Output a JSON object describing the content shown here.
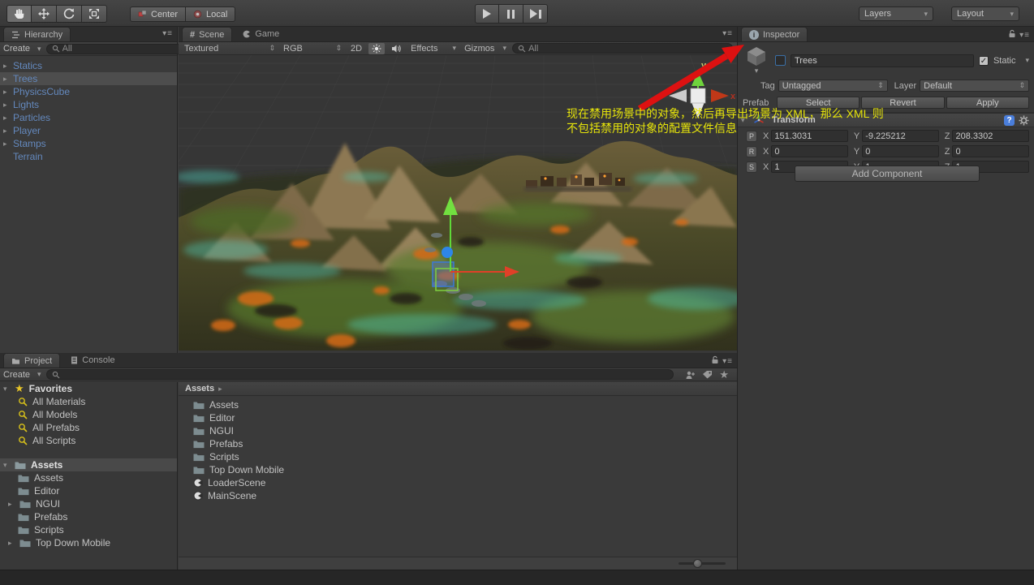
{
  "toolbar": {
    "center_label": "Center",
    "local_label": "Local",
    "layers_label": "Layers",
    "layout_label": "Layout"
  },
  "hierarchy": {
    "tab_label": "Hierarchy",
    "create_label": "Create",
    "search_placeholder": "All",
    "items": [
      {
        "label": "Statics"
      },
      {
        "label": "Trees"
      },
      {
        "label": "PhysicsCube"
      },
      {
        "label": "Lights"
      },
      {
        "label": "Particles"
      },
      {
        "label": "Player"
      },
      {
        "label": "Stamps"
      },
      {
        "label": "Terrain"
      }
    ]
  },
  "scene": {
    "tab_scene": "Scene",
    "tab_game": "Game",
    "shading_mode": "Textured",
    "render_mode": "RGB",
    "mode_2d_label": "2D",
    "effects_label": "Effects",
    "gizmos_label": "Gizmos",
    "search_placeholder": "All",
    "axis_label_x": "x",
    "axis_label_y": "y",
    "annotation_line1": "现在禁用场景中的对象，然后再导出场景为 XML，那么 XML 则",
    "annotation_line2": "不包括禁用的对象的配置文件信息",
    "annotation_color": "#e6e40a",
    "arrow_color": "#dd1111"
  },
  "inspector": {
    "tab_label": "Inspector",
    "object_name": "Trees",
    "object_active": false,
    "static_label": "Static",
    "static_checked": true,
    "tag_label": "Tag",
    "tag_value": "Untagged",
    "layer_label": "Layer",
    "layer_value": "Default",
    "prefab_label": "Prefab",
    "prefab_select": "Select",
    "prefab_revert": "Revert",
    "prefab_apply": "Apply",
    "transform": {
      "title": "Transform",
      "axes": [
        "X",
        "Y",
        "Z"
      ],
      "rows": [
        {
          "key": "P",
          "x": "151.3031",
          "y": "-9.225212",
          "z": "208.3302"
        },
        {
          "key": "R",
          "x": "0",
          "y": "0",
          "z": "0"
        },
        {
          "key": "S",
          "x": "1",
          "y": "1",
          "z": "1"
        }
      ]
    },
    "add_component_label": "Add Component"
  },
  "project": {
    "tab_project": "Project",
    "tab_console": "Console",
    "create_label": "Create",
    "favorites_label": "Favorites",
    "favorites": [
      {
        "label": "All Materials"
      },
      {
        "label": "All Models"
      },
      {
        "label": "All Prefabs"
      },
      {
        "label": "All Scripts"
      }
    ],
    "root_label": "Assets",
    "tree": [
      {
        "label": "Assets"
      },
      {
        "label": "Editor"
      },
      {
        "label": "NGUI"
      },
      {
        "label": "Prefabs"
      },
      {
        "label": "Scripts"
      },
      {
        "label": "Top Down Mobile"
      }
    ],
    "breadcrumb": "Assets",
    "folders": [
      {
        "label": "Assets"
      },
      {
        "label": "Editor"
      },
      {
        "label": "NGUI"
      },
      {
        "label": "Prefabs"
      },
      {
        "label": "Scripts"
      },
      {
        "label": "Top Down Mobile"
      }
    ],
    "scenes": [
      {
        "label": "LoaderScene"
      },
      {
        "label": "MainScene"
      }
    ]
  }
}
